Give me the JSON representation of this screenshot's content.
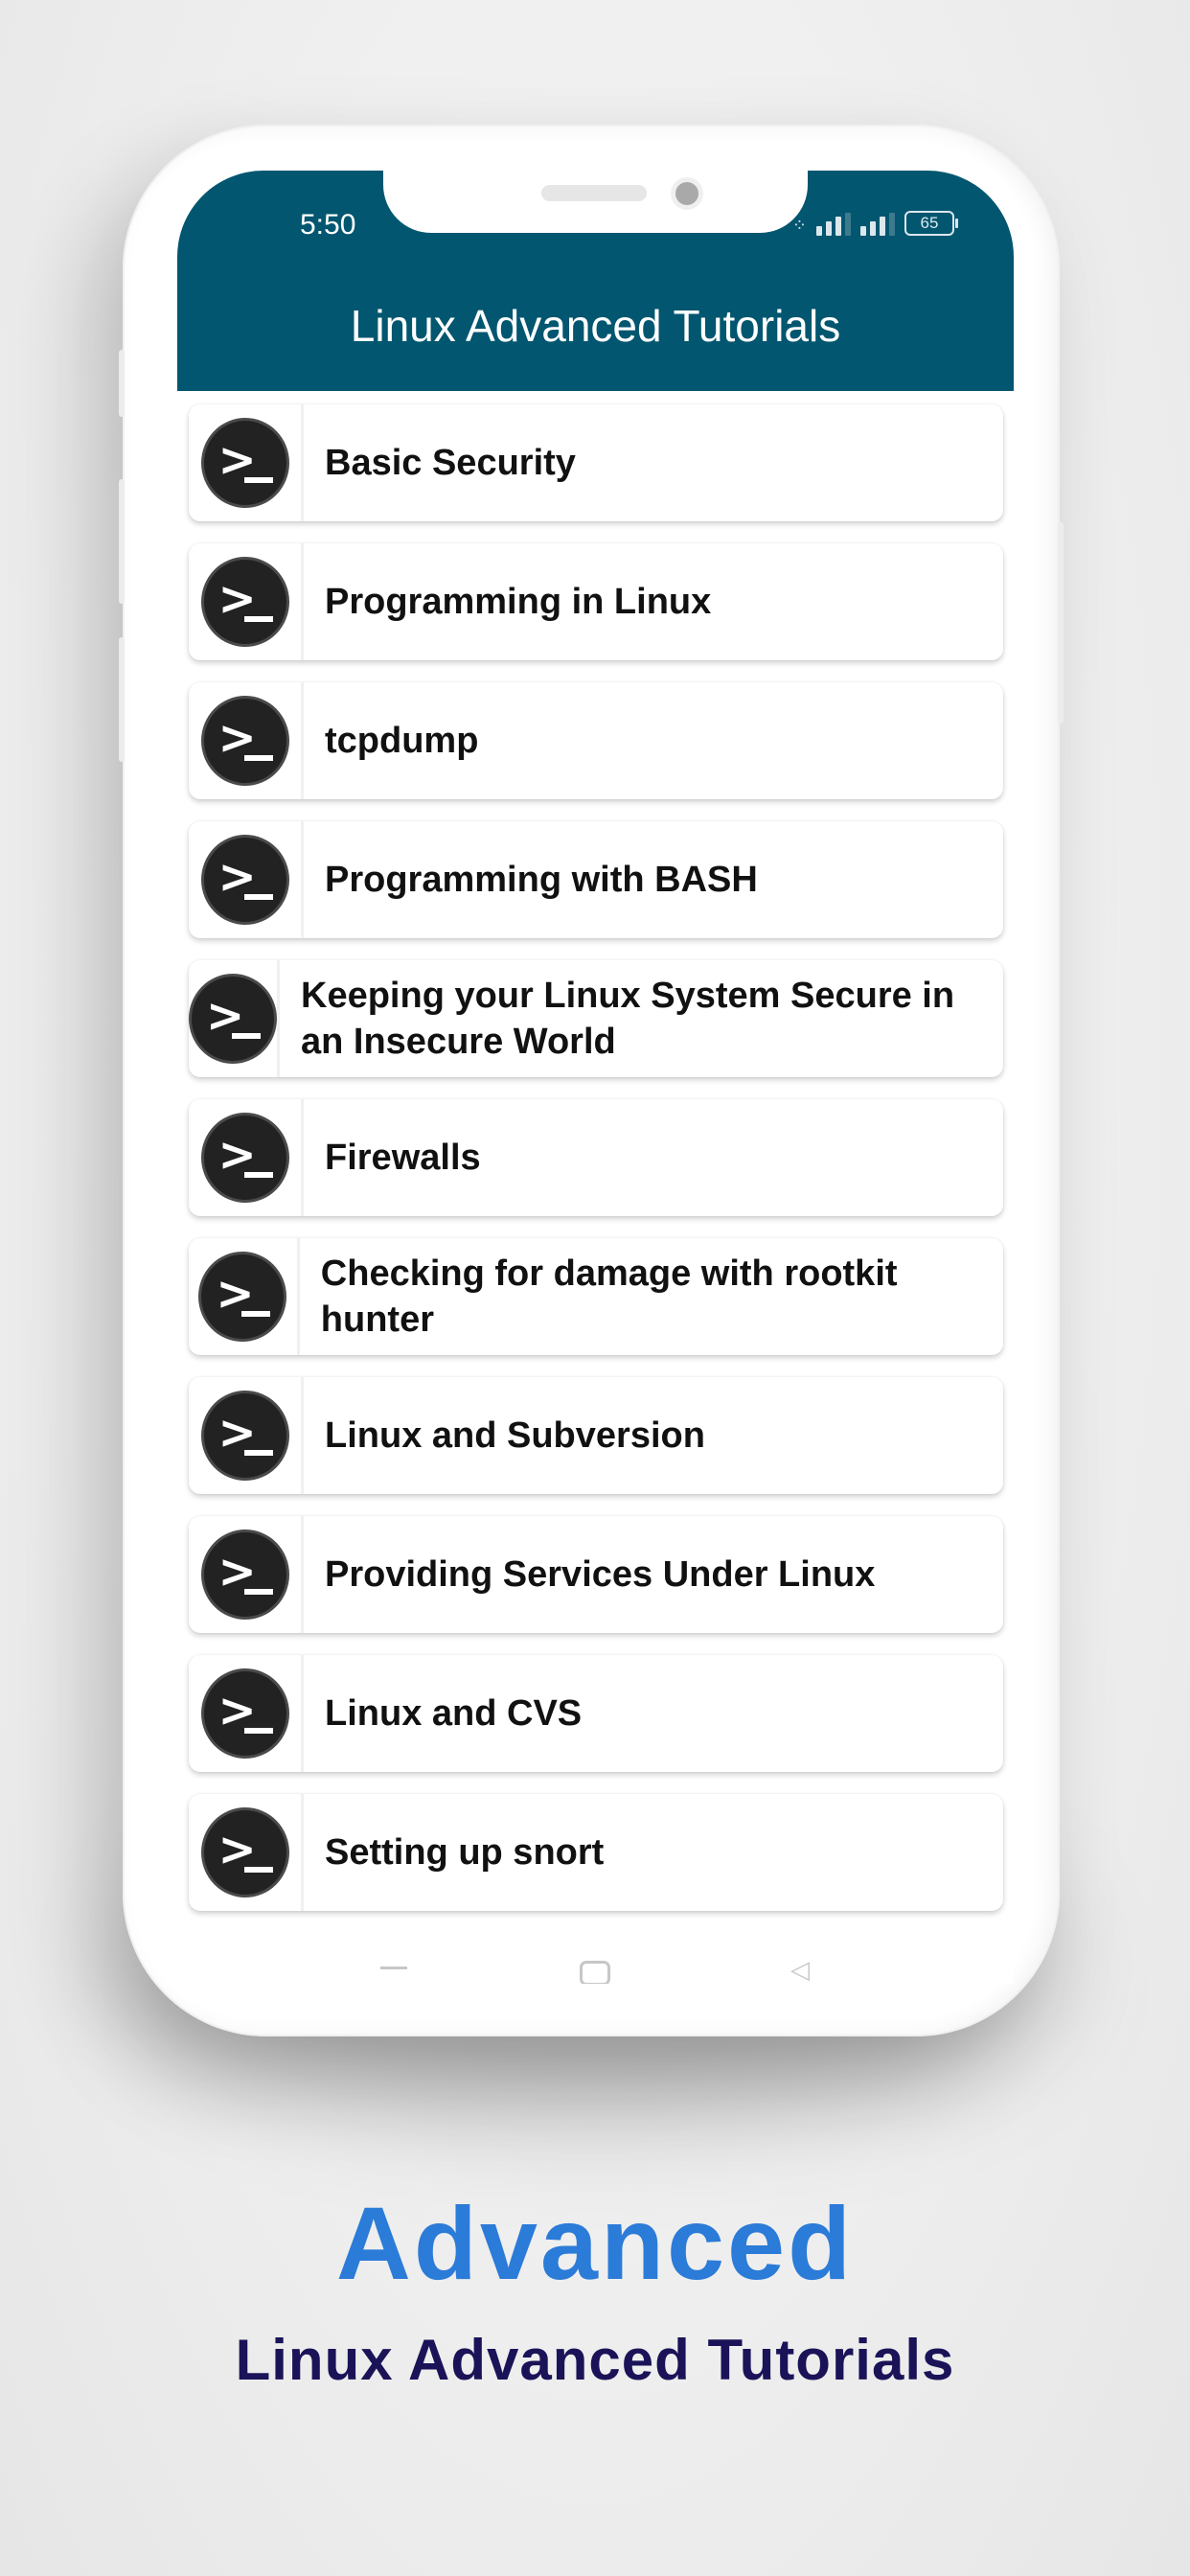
{
  "status_bar": {
    "time": "5:50",
    "battery": "65"
  },
  "app_bar": {
    "title": "Linux Advanced Tutorials"
  },
  "list": {
    "items": [
      {
        "label": "Basic Security",
        "icon": "terminal-icon"
      },
      {
        "label": "Programming in Linux",
        "icon": "terminal-icon"
      },
      {
        "label": "tcpdump",
        "icon": "terminal-icon"
      },
      {
        "label": "Programming with BASH",
        "icon": "terminal-icon"
      },
      {
        "label": "Keeping your Linux System Secure in an Insecure World",
        "icon": "terminal-icon"
      },
      {
        "label": "Firewalls",
        "icon": "terminal-icon"
      },
      {
        "label": "Checking for damage with rootkit hunter",
        "icon": "terminal-icon"
      },
      {
        "label": "Linux and Subversion",
        "icon": "terminal-icon"
      },
      {
        "label": "Providing Services Under Linux",
        "icon": "terminal-icon"
      },
      {
        "label": "Linux and CVS",
        "icon": "terminal-icon"
      },
      {
        "label": "Setting up snort",
        "icon": "terminal-icon"
      }
    ]
  },
  "promo": {
    "headline": "Advanced",
    "subtitle": "Linux Advanced Tutorials"
  },
  "colors": {
    "app_bar": "#02566f",
    "headline": "#2b7bd8",
    "subtitle": "#1a1358"
  }
}
